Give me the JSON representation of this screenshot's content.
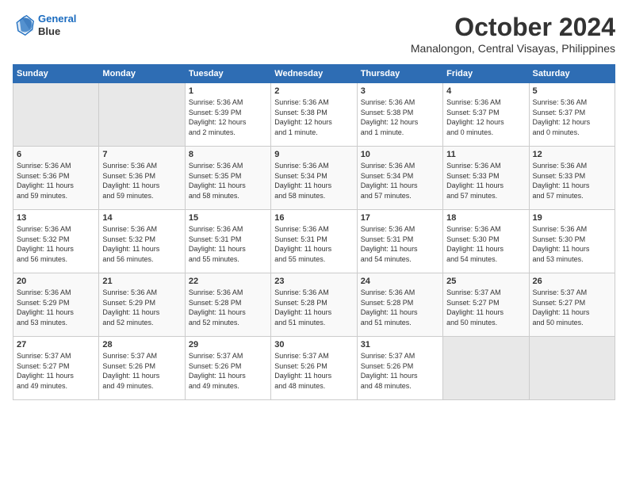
{
  "header": {
    "logo_line1": "General",
    "logo_line2": "Blue",
    "month": "October 2024",
    "location": "Manalongon, Central Visayas, Philippines"
  },
  "days_of_week": [
    "Sunday",
    "Monday",
    "Tuesday",
    "Wednesday",
    "Thursday",
    "Friday",
    "Saturday"
  ],
  "weeks": [
    [
      {
        "day": "",
        "info": ""
      },
      {
        "day": "",
        "info": ""
      },
      {
        "day": "1",
        "info": "Sunrise: 5:36 AM\nSunset: 5:39 PM\nDaylight: 12 hours\nand 2 minutes."
      },
      {
        "day": "2",
        "info": "Sunrise: 5:36 AM\nSunset: 5:38 PM\nDaylight: 12 hours\nand 1 minute."
      },
      {
        "day": "3",
        "info": "Sunrise: 5:36 AM\nSunset: 5:38 PM\nDaylight: 12 hours\nand 1 minute."
      },
      {
        "day": "4",
        "info": "Sunrise: 5:36 AM\nSunset: 5:37 PM\nDaylight: 12 hours\nand 0 minutes."
      },
      {
        "day": "5",
        "info": "Sunrise: 5:36 AM\nSunset: 5:37 PM\nDaylight: 12 hours\nand 0 minutes."
      }
    ],
    [
      {
        "day": "6",
        "info": "Sunrise: 5:36 AM\nSunset: 5:36 PM\nDaylight: 11 hours\nand 59 minutes."
      },
      {
        "day": "7",
        "info": "Sunrise: 5:36 AM\nSunset: 5:36 PM\nDaylight: 11 hours\nand 59 minutes."
      },
      {
        "day": "8",
        "info": "Sunrise: 5:36 AM\nSunset: 5:35 PM\nDaylight: 11 hours\nand 58 minutes."
      },
      {
        "day": "9",
        "info": "Sunrise: 5:36 AM\nSunset: 5:34 PM\nDaylight: 11 hours\nand 58 minutes."
      },
      {
        "day": "10",
        "info": "Sunrise: 5:36 AM\nSunset: 5:34 PM\nDaylight: 11 hours\nand 57 minutes."
      },
      {
        "day": "11",
        "info": "Sunrise: 5:36 AM\nSunset: 5:33 PM\nDaylight: 11 hours\nand 57 minutes."
      },
      {
        "day": "12",
        "info": "Sunrise: 5:36 AM\nSunset: 5:33 PM\nDaylight: 11 hours\nand 57 minutes."
      }
    ],
    [
      {
        "day": "13",
        "info": "Sunrise: 5:36 AM\nSunset: 5:32 PM\nDaylight: 11 hours\nand 56 minutes."
      },
      {
        "day": "14",
        "info": "Sunrise: 5:36 AM\nSunset: 5:32 PM\nDaylight: 11 hours\nand 56 minutes."
      },
      {
        "day": "15",
        "info": "Sunrise: 5:36 AM\nSunset: 5:31 PM\nDaylight: 11 hours\nand 55 minutes."
      },
      {
        "day": "16",
        "info": "Sunrise: 5:36 AM\nSunset: 5:31 PM\nDaylight: 11 hours\nand 55 minutes."
      },
      {
        "day": "17",
        "info": "Sunrise: 5:36 AM\nSunset: 5:31 PM\nDaylight: 11 hours\nand 54 minutes."
      },
      {
        "day": "18",
        "info": "Sunrise: 5:36 AM\nSunset: 5:30 PM\nDaylight: 11 hours\nand 54 minutes."
      },
      {
        "day": "19",
        "info": "Sunrise: 5:36 AM\nSunset: 5:30 PM\nDaylight: 11 hours\nand 53 minutes."
      }
    ],
    [
      {
        "day": "20",
        "info": "Sunrise: 5:36 AM\nSunset: 5:29 PM\nDaylight: 11 hours\nand 53 minutes."
      },
      {
        "day": "21",
        "info": "Sunrise: 5:36 AM\nSunset: 5:29 PM\nDaylight: 11 hours\nand 52 minutes."
      },
      {
        "day": "22",
        "info": "Sunrise: 5:36 AM\nSunset: 5:28 PM\nDaylight: 11 hours\nand 52 minutes."
      },
      {
        "day": "23",
        "info": "Sunrise: 5:36 AM\nSunset: 5:28 PM\nDaylight: 11 hours\nand 51 minutes."
      },
      {
        "day": "24",
        "info": "Sunrise: 5:36 AM\nSunset: 5:28 PM\nDaylight: 11 hours\nand 51 minutes."
      },
      {
        "day": "25",
        "info": "Sunrise: 5:37 AM\nSunset: 5:27 PM\nDaylight: 11 hours\nand 50 minutes."
      },
      {
        "day": "26",
        "info": "Sunrise: 5:37 AM\nSunset: 5:27 PM\nDaylight: 11 hours\nand 50 minutes."
      }
    ],
    [
      {
        "day": "27",
        "info": "Sunrise: 5:37 AM\nSunset: 5:27 PM\nDaylight: 11 hours\nand 49 minutes."
      },
      {
        "day": "28",
        "info": "Sunrise: 5:37 AM\nSunset: 5:26 PM\nDaylight: 11 hours\nand 49 minutes."
      },
      {
        "day": "29",
        "info": "Sunrise: 5:37 AM\nSunset: 5:26 PM\nDaylight: 11 hours\nand 49 minutes."
      },
      {
        "day": "30",
        "info": "Sunrise: 5:37 AM\nSunset: 5:26 PM\nDaylight: 11 hours\nand 48 minutes."
      },
      {
        "day": "31",
        "info": "Sunrise: 5:37 AM\nSunset: 5:26 PM\nDaylight: 11 hours\nand 48 minutes."
      },
      {
        "day": "",
        "info": ""
      },
      {
        "day": "",
        "info": ""
      }
    ]
  ]
}
